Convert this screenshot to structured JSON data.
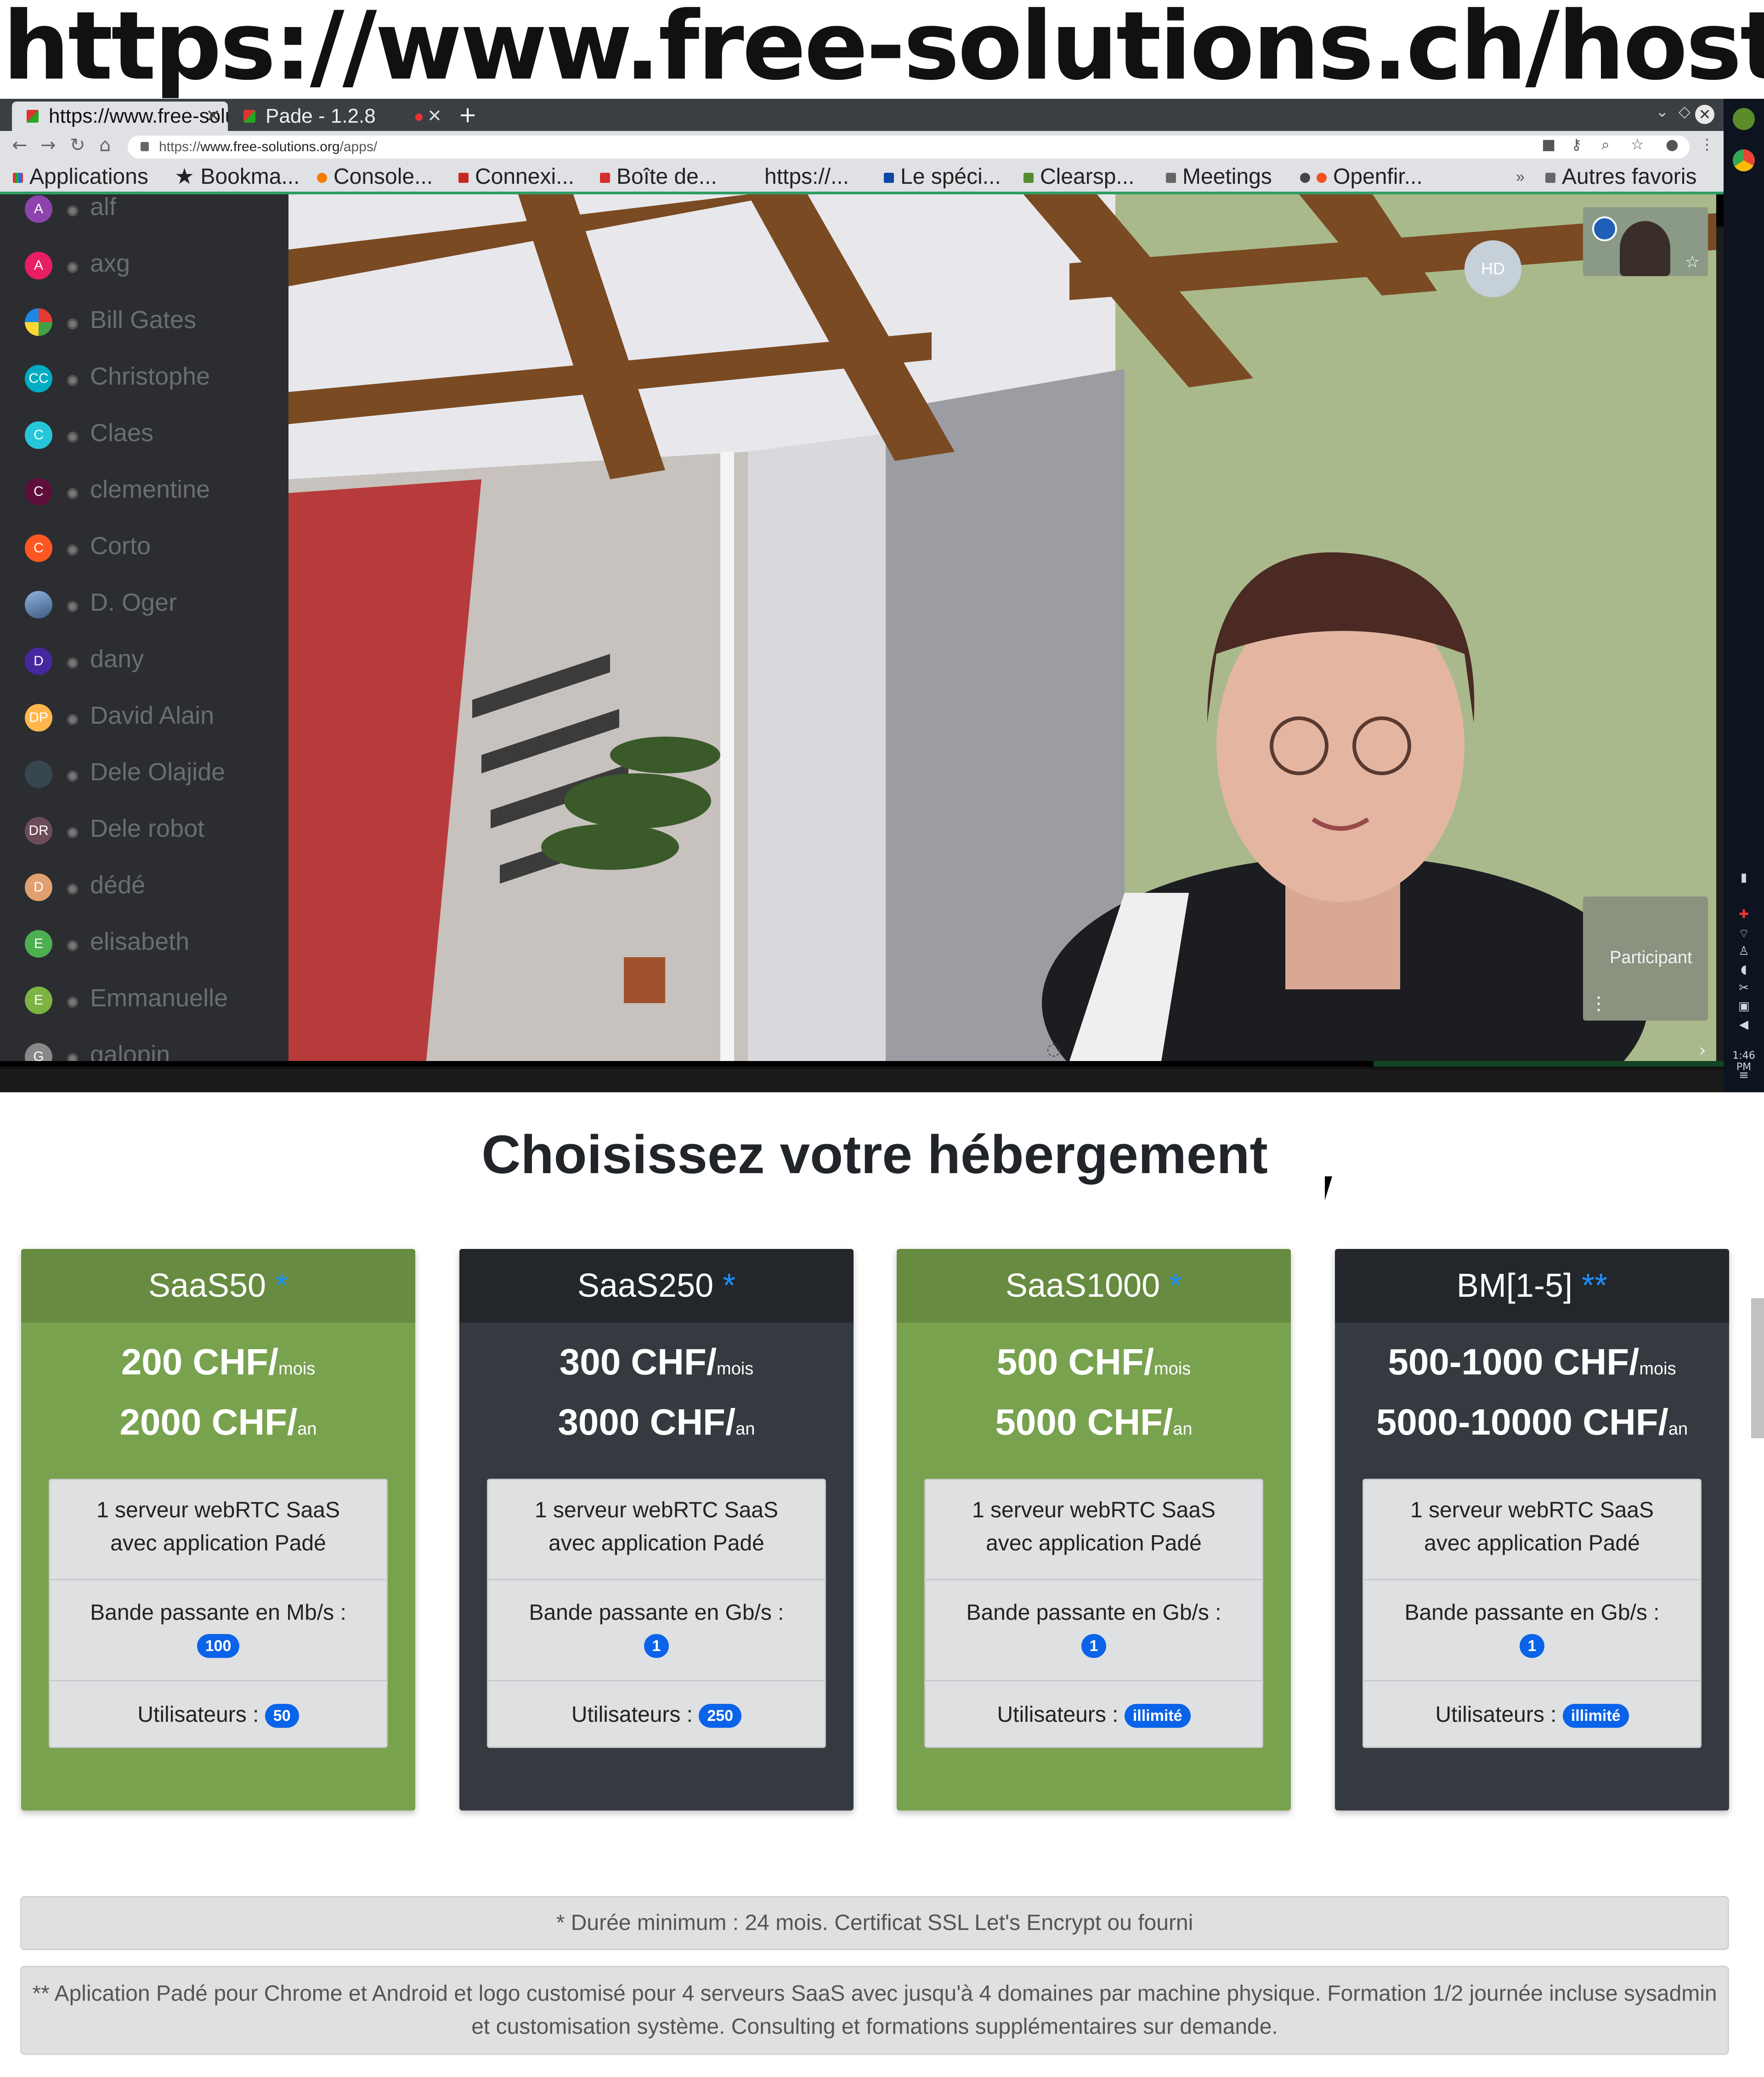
{
  "banner": {
    "url": "https://www.free-solutions.ch/hosting"
  },
  "browser": {
    "tabs": [
      {
        "title": "https://www.free-solutions.org/apps/",
        "active": true
      },
      {
        "title": "Pade - 1.2.8",
        "active": false
      }
    ],
    "address": {
      "prefix": "https://",
      "domain": "www.free-solutions.org",
      "path": "/apps/"
    },
    "bookmarks": [
      "Applications",
      "Bookma...",
      "Console...",
      "Connexi...",
      "Boîte de...",
      "https://...",
      "Le spéci...",
      "Clearsp...",
      "Meetings",
      "Openfir...",
      "Autres favoris"
    ]
  },
  "contacts": [
    {
      "initials": "A",
      "name": "alf",
      "color": "#8e44ad"
    },
    {
      "initials": "A",
      "name": "axg",
      "color": "#e91e63"
    },
    {
      "initials": "",
      "name": "Bill Gates",
      "color": "#2e7d32"
    },
    {
      "initials": "CC",
      "name": "Christophe",
      "color": "#00acc1"
    },
    {
      "initials": "C",
      "name": "Claes",
      "color": "#26c6da"
    },
    {
      "initials": "C",
      "name": "clementine",
      "color": "#5d0e3a"
    },
    {
      "initials": "C",
      "name": "Corto",
      "color": "#ff5722"
    },
    {
      "initials": "",
      "name": "D. Oger",
      "color": "#5c7aa8"
    },
    {
      "initials": "D",
      "name": "dany",
      "color": "#4527a0"
    },
    {
      "initials": "DP",
      "name": "David Alain",
      "color": "#ffb74d"
    },
    {
      "initials": "",
      "name": "Dele Olajide",
      "color": "#37474f"
    },
    {
      "initials": "DR",
      "name": "Dele robot",
      "color": "#6d4c5a"
    },
    {
      "initials": "D",
      "name": "dédé",
      "color": "#e0a070"
    },
    {
      "initials": "E",
      "name": "elisabeth",
      "color": "#4caf50"
    },
    {
      "initials": "E",
      "name": "Emmanuelle",
      "color": "#7cb342"
    },
    {
      "initials": "G",
      "name": "galopin",
      "color": "#888888"
    }
  ],
  "video": {
    "hd_label": "HD",
    "participant_label": "Participant"
  },
  "page": {
    "heading": "Choisissez votre hébergement",
    "plans": [
      {
        "name": "SaaS50",
        "mark": "*",
        "monthly": "200 CHF/",
        "yearly": "2000 CHF/",
        "mois": "mois",
        "an": "an",
        "server": "1 serveur webRTC SaaS avec application Padé",
        "bandwidth_label": "Bande passante en Mb/s :",
        "bandwidth": "100",
        "users_label": "Utilisateurs :",
        "users": "50",
        "theme": "green"
      },
      {
        "name": "SaaS250",
        "mark": "*",
        "monthly": "300 CHF/",
        "yearly": "3000 CHF/",
        "mois": "mois",
        "an": "an",
        "server": "1 serveur webRTC SaaS avec application Padé",
        "bandwidth_label": "Bande passante en Gb/s :",
        "bandwidth": "1",
        "users_label": "Utilisateurs :",
        "users": "250",
        "theme": "dark"
      },
      {
        "name": "SaaS1000",
        "mark": "*",
        "monthly": "500 CHF/",
        "yearly": "5000 CHF/",
        "mois": "mois",
        "an": "an",
        "server": "1 serveur webRTC SaaS avec application Padé",
        "bandwidth_label": "Bande passante en Gb/s :",
        "bandwidth": "1",
        "users_label": "Utilisateurs :",
        "users": "illimité",
        "theme": "green"
      },
      {
        "name": "BM[1-5]",
        "mark": "**",
        "monthly": "500-1000 CHF/",
        "yearly": "5000-10000 CHF/",
        "mois": "mois",
        "an": "an",
        "server": "1 serveur webRTC SaaS avec application Padé",
        "bandwidth_label": "Bande passante en Gb/s :",
        "bandwidth": "1",
        "users_label": "Utilisateurs :",
        "users": "illimité",
        "theme": "dark"
      }
    ],
    "note1": "* Durée minimum : 24 mois. Certificat SSL Let's Encrypt ou fourni",
    "note2": "** Aplication Padé pour Chrome et Android et logo customisé pour 4 serveurs SaaS avec jusqu'à 4 domaines par machine physique. Formation 1/2 journée incluse sysadmin et customisation système. Consulting et formations supplémentaires sur demande."
  },
  "taskbar": {
    "time": "1:46 PM"
  }
}
